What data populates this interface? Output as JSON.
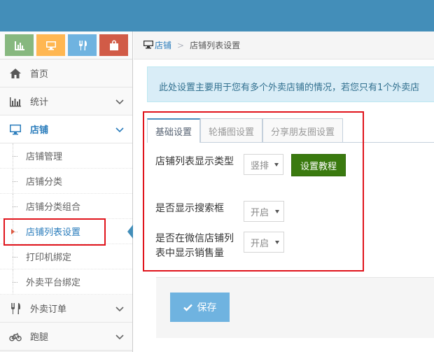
{
  "sidebar": {
    "shortcuts": [
      {
        "name": "chart-icon",
        "color": "#87b87f"
      },
      {
        "name": "desktop-icon",
        "color": "#ffb752"
      },
      {
        "name": "utensils-icon",
        "color": "#6fb3e0"
      },
      {
        "name": "shopping-bag-icon",
        "color": "#d15b47"
      }
    ],
    "items": [
      {
        "label": "首页",
        "icon": "home-icon"
      },
      {
        "label": "统计",
        "icon": "bar-chart-icon"
      },
      {
        "label": "店铺",
        "icon": "desktop-icon"
      },
      {
        "label": "外卖订单",
        "icon": "utensils-icon"
      },
      {
        "label": "跑腿",
        "icon": "bicycle-icon"
      }
    ],
    "submenu": [
      "店铺管理",
      "店铺分类",
      "店铺分类组合",
      "店铺列表设置",
      "打印机绑定",
      "外卖平台绑定"
    ]
  },
  "breadcrumb": {
    "home": "店铺",
    "current": "店铺列表设置"
  },
  "alert": "此处设置主要用于您有多个外卖店铺的情况，若您只有1个外卖店",
  "tabs": [
    "基础设置",
    "轮播图设置",
    "分享朋友圈设置"
  ],
  "form": {
    "list_type_label": "店铺列表显示类型",
    "list_type_value": "竖排",
    "tutorial_button": "设置教程",
    "search_label": "是否显示搜索框",
    "search_value": "开启",
    "sales_label_line1": "是否在微信店铺列",
    "sales_label_line2": "表中显示销售量",
    "sales_value": "开启"
  },
  "save_button": "保存",
  "colors": {
    "accent": "#438eb9",
    "highlight": "#e0141c",
    "tutorial_green": "#3a7a0f",
    "save_blue": "#6fb3e0"
  }
}
